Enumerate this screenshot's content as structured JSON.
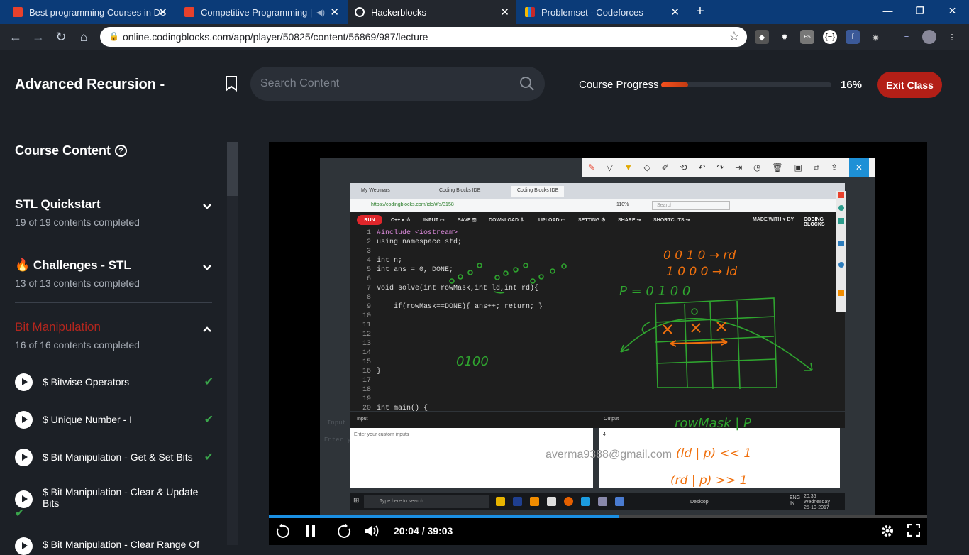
{
  "browser": {
    "tabs": [
      {
        "title": "Best programming Courses in De",
        "color": "#e8412c"
      },
      {
        "title": "Competitive Programming | ",
        "color": "#e8412c"
      },
      {
        "title": "Hackerblocks",
        "color": "#ffffff"
      },
      {
        "title": "Problemset - Codeforces",
        "color": "#1e88e5"
      }
    ],
    "url": "online.codingblocks.com/app/player/50825/content/56869/987/lecture"
  },
  "header": {
    "title": "Advanced Recursion -",
    "search_placeholder": "Search Content",
    "progress_label": "Course Progress",
    "progress_value": 0.16,
    "progress_text": "16%",
    "exit_label": "Exit Class"
  },
  "sidebar": {
    "title": "Course Content",
    "sections": [
      {
        "title": "STL Quickstart",
        "subtitle": "19 of 19 contents completed",
        "expanded": false
      },
      {
        "title": "Challenges - STL",
        "subtitle": "13 of 13 contents completed",
        "expanded": false,
        "icon": "fire-icon"
      },
      {
        "title": "Bit Manipulation",
        "subtitle": "16 of 16 contents completed",
        "expanded": true,
        "accent": "#b3261e"
      }
    ],
    "lectures": [
      {
        "name": "$ Bitwise Operators",
        "done": true
      },
      {
        "name": "$ Unique Number - I",
        "done": true
      },
      {
        "name": "$ Bit Manipulation - Get & Set Bits",
        "done": true
      },
      {
        "name": "$ Bit Manipulation - Clear & Update Bits",
        "done": true
      },
      {
        "name": "$ Bit Manipulation - Clear Range Of",
        "done": false
      }
    ]
  },
  "video": {
    "annotation_tools": [
      "✎",
      "▽",
      "▼",
      "◇",
      "✐",
      "⟲",
      "↶",
      "↷",
      "⇥",
      "◷",
      "🗑",
      "▣",
      "⧉",
      "⇪",
      "×"
    ],
    "inner_browser": {
      "tabs": [
        "My Webinars",
        "Coding Blocks IDE",
        "Coding Blocks IDE"
      ],
      "url": "https://codingblocks.com/ide/#/s/3158",
      "zoom": "110%",
      "search": "Search"
    },
    "ide": {
      "run": "RUN",
      "lang": "C++ ▾ ‹/›",
      "menu": [
        "INPUT ▭",
        "SAVE 🖫",
        "DOWNLOAD ⇩",
        "UPLOAD ▭",
        "SETTING ⚙",
        "SHARE ↪",
        "SHORTCUTS ↪"
      ],
      "made_with": "MADE WITH ♥ BY",
      "brand": "CODING BLOCKS"
    },
    "code_lines": [
      {
        "n": "1",
        "t": "#include <iostream>"
      },
      {
        "n": "2",
        "t": "using namespace std;"
      },
      {
        "n": "3",
        "t": ""
      },
      {
        "n": "4",
        "t": "int n;"
      },
      {
        "n": "5",
        "t": "int ans = 0, DONE;"
      },
      {
        "n": "6",
        "t": ""
      },
      {
        "n": "7",
        "t": "void solve(int rowMask,int ld,int rd){"
      },
      {
        "n": "8",
        "t": ""
      },
      {
        "n": "9",
        "t": "    if(rowMask==DONE){ ans++; return; }"
      },
      {
        "n": "10",
        "t": ""
      },
      {
        "n": "11",
        "t": ""
      },
      {
        "n": "12",
        "t": ""
      },
      {
        "n": "13",
        "t": ""
      },
      {
        "n": "14",
        "t": ""
      },
      {
        "n": "15",
        "t": ""
      },
      {
        "n": "16",
        "t": "}"
      },
      {
        "n": "17",
        "t": ""
      },
      {
        "n": "18",
        "t": ""
      },
      {
        "n": "19",
        "t": ""
      },
      {
        "n": "20",
        "t": "int main() {"
      }
    ],
    "io": {
      "input_label": "Input",
      "output_label": "Output",
      "input_placeholder": "Enter your custom inputs",
      "output_value": "4"
    },
    "watermark": "averma9388@gmail.com",
    "taskbar": {
      "search": "Type here to search",
      "desktop": "Desktop",
      "lang": "ENG IN",
      "time": "20:36",
      "day": "Wednesday",
      "date": "25-10-2017"
    },
    "ink": {
      "green_bits": "0100",
      "orange_row1": "0 0 1 0 → rd",
      "orange_row2": "1 0 0 0 → ld",
      "p_label": "P = 0 1 0 0",
      "row_mask": "rowMask | P",
      "ld_expr": "(ld | p) << 1",
      "rd_expr": "(rd | p) >> 1"
    },
    "player": {
      "elapsed": 1244,
      "duration": 2343,
      "time_text": "20:04 / 39:03"
    }
  }
}
